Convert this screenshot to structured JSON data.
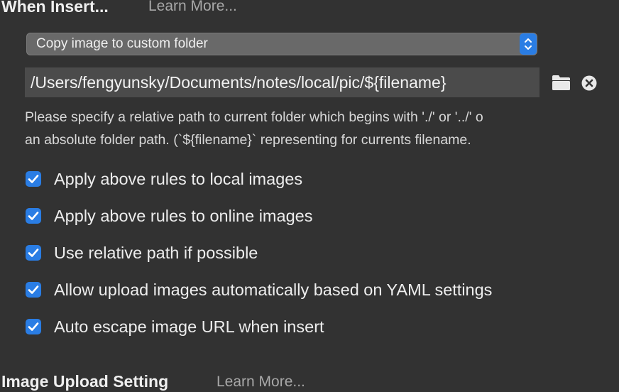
{
  "insert_section": {
    "title": "When Insert...",
    "learn_more": "Learn More..."
  },
  "insert_action": {
    "selected": "Copy image to custom folder"
  },
  "custom_folder": {
    "value": "/Users/fengyunsky/Documents/notes/local/pic/${filename}",
    "browse_icon": "folder-icon",
    "clear_icon": "clear-icon"
  },
  "help": {
    "line1": " Please specify a relative path to current folder which begins with './' or '../' o",
    "line2": "an absolute folder path. (`${filename}` representing for currents filename."
  },
  "options": [
    {
      "label": "Apply above rules to local images",
      "checked": true
    },
    {
      "label": "Apply above rules to online images",
      "checked": true
    },
    {
      "label": "Use relative path if possible",
      "checked": true
    },
    {
      "label": "Allow upload images automatically based on YAML settings",
      "checked": true
    },
    {
      "label": "Auto escape image URL when insert",
      "checked": true
    }
  ],
  "upload_section": {
    "title": "Image Upload Setting",
    "learn_more": "Learn More..."
  },
  "colors": {
    "background": "#323232",
    "accent": "#2a7de4",
    "field": "#4b4b4b",
    "select": "#696969"
  }
}
